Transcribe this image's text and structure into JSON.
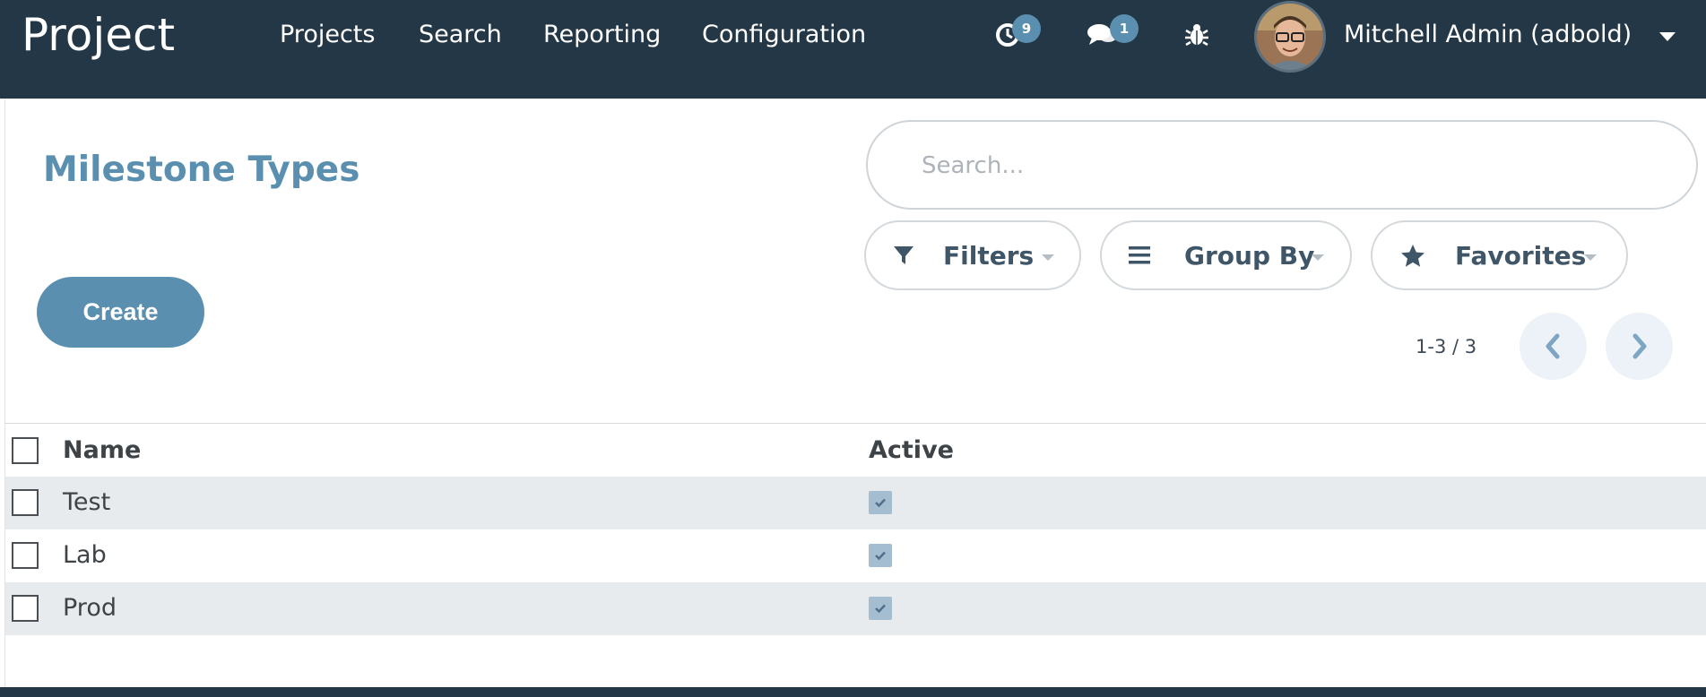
{
  "navbar": {
    "brand": "Project",
    "menu": [
      "Projects",
      "Search",
      "Reporting",
      "Configuration"
    ],
    "activity_count": "9",
    "message_count": "1",
    "user": "Mitchell Admin (adbold)"
  },
  "page": {
    "title": "Milestone Types",
    "create_label": "Create"
  },
  "search": {
    "placeholder": "Search...",
    "filters_label": "Filters",
    "groupby_label": "Group By",
    "favorites_label": "Favorites"
  },
  "pager": {
    "value": "1-3 / 3"
  },
  "table": {
    "columns": [
      "Name",
      "Active"
    ],
    "rows": [
      {
        "name": "Test",
        "active": true
      },
      {
        "name": "Lab",
        "active": true
      },
      {
        "name": "Prod",
        "active": true
      }
    ]
  },
  "colors": {
    "navbar": "#243746",
    "accent": "#5b8fb0",
    "row_stripe": "#e8ebee"
  }
}
